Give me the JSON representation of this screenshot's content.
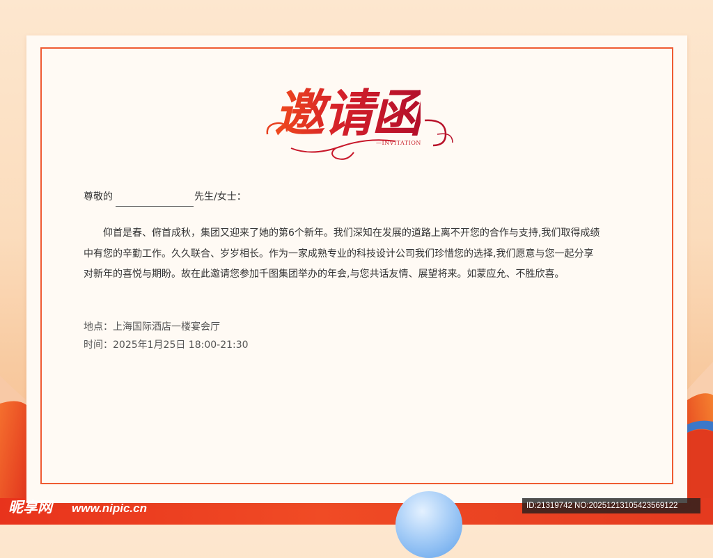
{
  "title": {
    "main": "邀请函",
    "sub": "—INVITATION"
  },
  "greeting": {
    "prefix": "尊敬的",
    "suffix": "先生/女士："
  },
  "body": {
    "lines": [
      "仰首是春、俯首成秋，集团又迎来了她的第6个新年。我们深知在发展的道路上离不开您的合作与支持,我们取得成绩",
      "中有您的辛勤工作。久久联合、岁岁相长。作为一家成熟专业的科技设计公司我们珍惜您的选择,我们愿意与您一起分享",
      "对新年的喜悦与期盼。故在此邀请您参加千图集团举办的年会,与您共话友情、展望将来。如蒙应允、不胜欣喜。"
    ]
  },
  "details": {
    "place": "地点：上海国际酒店一楼宴会厅",
    "time": "时间：2025年1月25日  18:00-21:30"
  },
  "watermark": {
    "logo": "昵享网",
    "url": "www.nipic.cn",
    "id": "ID:21319742 NO:20251213105423569122"
  },
  "colors": {
    "frame": "#ef5b32",
    "title_gradient_start": "#f04a1c",
    "title_gradient_end": "#b30f2a",
    "bottom_bar": "#e8331c"
  }
}
